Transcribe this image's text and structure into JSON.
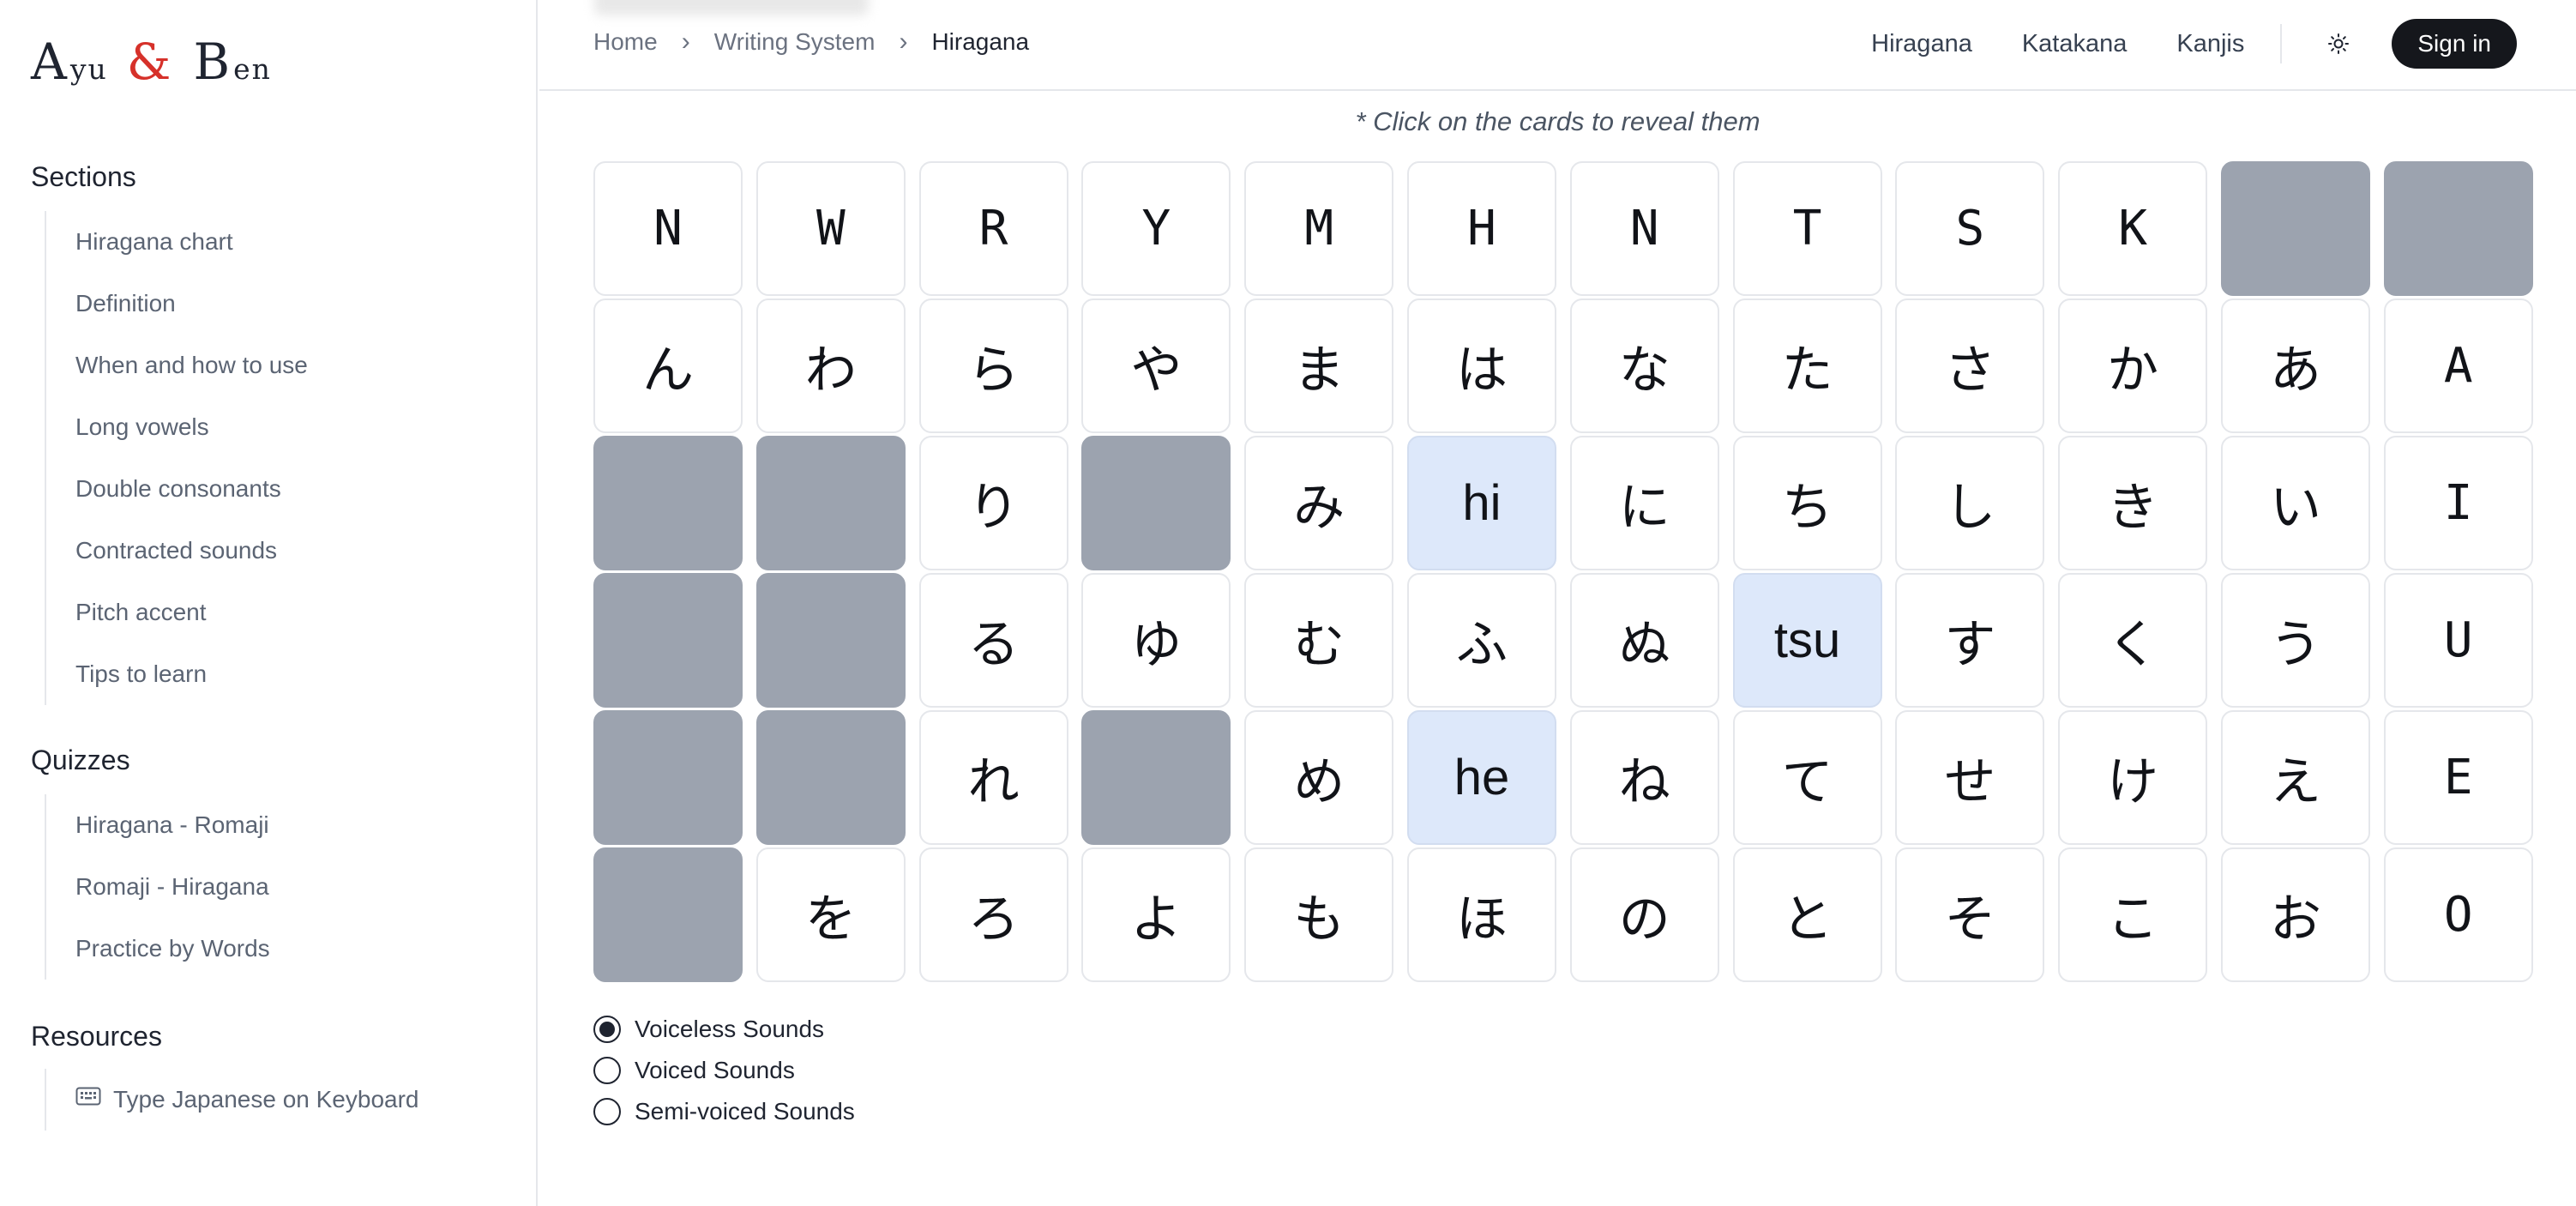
{
  "logo": {
    "a": "A",
    "yu": "yu",
    "amp": "&",
    "b": "B",
    "en": "en"
  },
  "sidebar": {
    "sections": {
      "title": "Sections",
      "items": [
        "Hiragana chart",
        "Definition",
        "When and how to use",
        "Long vowels",
        "Double consonants",
        "Contracted sounds",
        "Pitch accent",
        "Tips to learn"
      ]
    },
    "quizzes": {
      "title": "Quizzes",
      "items": [
        "Hiragana - Romaji",
        "Romaji - Hiragana",
        "Practice by Words"
      ]
    },
    "resources": {
      "title": "Resources",
      "items": [
        {
          "label": "Type Japanese on Keyboard",
          "icon": "keyboard-icon"
        }
      ]
    }
  },
  "breadcrumb": [
    "Home",
    "Writing System",
    "Hiragana"
  ],
  "topnav": {
    "links": [
      "Hiragana",
      "Katakana",
      "Kanjis"
    ],
    "theme_icon": "sun-icon",
    "sign_in": "Sign in"
  },
  "hint": "* Click on the cards to reveal them",
  "chart": {
    "rows": [
      [
        {
          "t": "N",
          "k": "head"
        },
        {
          "t": "W",
          "k": "head"
        },
        {
          "t": "R",
          "k": "head"
        },
        {
          "t": "Y",
          "k": "head"
        },
        {
          "t": "M",
          "k": "head"
        },
        {
          "t": "H",
          "k": "head"
        },
        {
          "t": "N",
          "k": "head"
        },
        {
          "t": "T",
          "k": "head"
        },
        {
          "t": "S",
          "k": "head"
        },
        {
          "t": "K",
          "k": "head"
        },
        {
          "t": "",
          "k": "empty"
        },
        {
          "t": "",
          "k": "empty"
        }
      ],
      [
        {
          "t": "ん",
          "k": "kana"
        },
        {
          "t": "わ",
          "k": "kana"
        },
        {
          "t": "ら",
          "k": "kana"
        },
        {
          "t": "や",
          "k": "kana"
        },
        {
          "t": "ま",
          "k": "kana"
        },
        {
          "t": "は",
          "k": "kana"
        },
        {
          "t": "な",
          "k": "kana"
        },
        {
          "t": "た",
          "k": "kana"
        },
        {
          "t": "さ",
          "k": "kana"
        },
        {
          "t": "か",
          "k": "kana"
        },
        {
          "t": "あ",
          "k": "kana"
        },
        {
          "t": "A",
          "k": "head"
        }
      ],
      [
        {
          "t": "",
          "k": "empty"
        },
        {
          "t": "",
          "k": "empty"
        },
        {
          "t": "り",
          "k": "kana"
        },
        {
          "t": "",
          "k": "empty"
        },
        {
          "t": "み",
          "k": "kana"
        },
        {
          "t": "hi",
          "k": "rev"
        },
        {
          "t": "に",
          "k": "kana"
        },
        {
          "t": "ち",
          "k": "kana"
        },
        {
          "t": "し",
          "k": "kana"
        },
        {
          "t": "き",
          "k": "kana"
        },
        {
          "t": "い",
          "k": "kana"
        },
        {
          "t": "I",
          "k": "head"
        }
      ],
      [
        {
          "t": "",
          "k": "empty"
        },
        {
          "t": "",
          "k": "empty"
        },
        {
          "t": "る",
          "k": "kana"
        },
        {
          "t": "ゆ",
          "k": "kana"
        },
        {
          "t": "む",
          "k": "kana"
        },
        {
          "t": "ふ",
          "k": "kana"
        },
        {
          "t": "ぬ",
          "k": "kana"
        },
        {
          "t": "tsu",
          "k": "rev"
        },
        {
          "t": "す",
          "k": "kana"
        },
        {
          "t": "く",
          "k": "kana"
        },
        {
          "t": "う",
          "k": "kana"
        },
        {
          "t": "U",
          "k": "head"
        }
      ],
      [
        {
          "t": "",
          "k": "empty"
        },
        {
          "t": "",
          "k": "empty"
        },
        {
          "t": "れ",
          "k": "kana"
        },
        {
          "t": "",
          "k": "empty"
        },
        {
          "t": "め",
          "k": "kana"
        },
        {
          "t": "he",
          "k": "rev"
        },
        {
          "t": "ね",
          "k": "kana"
        },
        {
          "t": "て",
          "k": "kana"
        },
        {
          "t": "せ",
          "k": "kana"
        },
        {
          "t": "け",
          "k": "kana"
        },
        {
          "t": "え",
          "k": "kana"
        },
        {
          "t": "E",
          "k": "head"
        }
      ],
      [
        {
          "t": "",
          "k": "empty"
        },
        {
          "t": "を",
          "k": "kana"
        },
        {
          "t": "ろ",
          "k": "kana"
        },
        {
          "t": "よ",
          "k": "kana"
        },
        {
          "t": "も",
          "k": "kana"
        },
        {
          "t": "ほ",
          "k": "kana"
        },
        {
          "t": "の",
          "k": "kana"
        },
        {
          "t": "と",
          "k": "kana"
        },
        {
          "t": "そ",
          "k": "kana"
        },
        {
          "t": "こ",
          "k": "kana"
        },
        {
          "t": "お",
          "k": "kana"
        },
        {
          "t": "O",
          "k": "head"
        }
      ]
    ]
  },
  "sound_options": [
    {
      "label": "Voiceless Sounds",
      "selected": true
    },
    {
      "label": "Voiced Sounds",
      "selected": false
    },
    {
      "label": "Semi-voiced Sounds",
      "selected": false
    }
  ],
  "colors": {
    "accent_red": "#d6312a",
    "revealed_bg": "#dde8fa",
    "empty_card": "#9ca3af",
    "signin_bg": "#15171c"
  }
}
